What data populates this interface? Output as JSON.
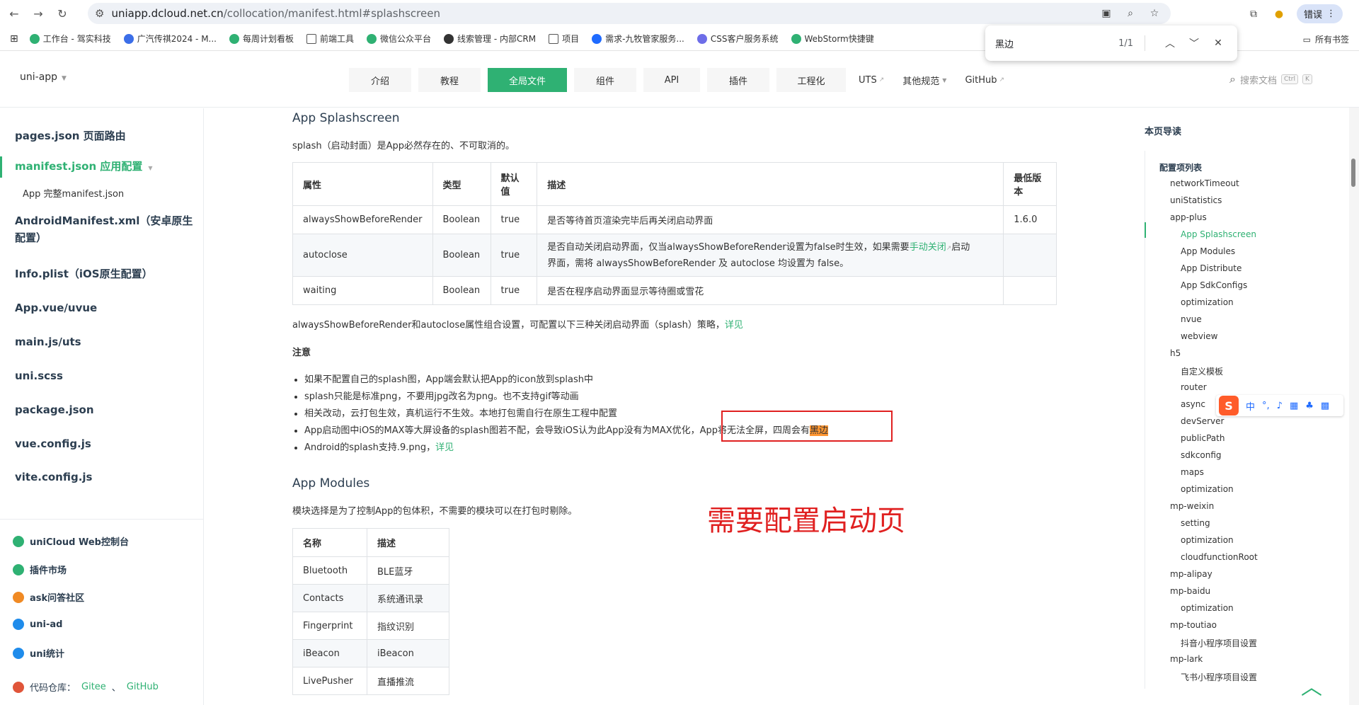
{
  "browser": {
    "url_site": "uniapp.dcloud.net.cn",
    "url_path": "/collocation/manifest.html#splashscreen",
    "error_badge": "错误",
    "bookmarks": [
      {
        "label": "工作台 - 驾实科技",
        "color": "#2fb173"
      },
      {
        "label": "广汽传祺2024 - M...",
        "color": "#3b6ee8"
      },
      {
        "label": "每周计划看板",
        "color": "#2fb173"
      },
      {
        "label": "前端工具",
        "color": ""
      },
      {
        "label": "微信公众平台",
        "color": "#2fb173"
      },
      {
        "label": "线索管理 - 内部CRM",
        "color": "#333"
      },
      {
        "label": "项目",
        "color": ""
      },
      {
        "label": "需求-九牧管家服务...",
        "color": "#1f6bff"
      },
      {
        "label": "CSS客户服务系统",
        "color": "#6d6de8"
      },
      {
        "label": "WebStorm快捷键",
        "color": "#2fb173"
      }
    ],
    "all_bookmarks": "所有书签"
  },
  "findbar": {
    "query": "黑边",
    "count": "1/1"
  },
  "header": {
    "brand": "uni-app",
    "nav": [
      {
        "label": "介绍",
        "active": false
      },
      {
        "label": "教程",
        "active": false
      },
      {
        "label": "全局文件",
        "active": true
      },
      {
        "label": "组件",
        "active": false
      },
      {
        "label": "API",
        "active": false
      },
      {
        "label": "插件",
        "active": false
      },
      {
        "label": "工程化",
        "active": false
      }
    ],
    "links": [
      "UTS",
      "其他规范",
      "GitHub"
    ],
    "search_placeholder": "搜索文档",
    "kbd1": "Ctrl",
    "kbd2": "K"
  },
  "sidebar": {
    "items": [
      "pages.json 页面路由",
      "manifest.json 应用配置",
      "App 完整manifest.json",
      "AndroidManifest.xml（安卓原生",
      "配置）",
      "Info.plist（iOS原生配置）",
      "App.vue/uvue",
      "main.js/uts",
      "uni.scss",
      "package.json",
      "vue.config.js",
      "vite.config.js"
    ],
    "footer": [
      {
        "label": "uniCloud Web控制台",
        "color": "#2fb173"
      },
      {
        "label": "插件市场",
        "color": "#2fb173"
      },
      {
        "label": "ask问答社区",
        "color": "#f08a24"
      },
      {
        "label": "uni-ad",
        "color": "#1f8ceb"
      },
      {
        "label": "uni统计",
        "color": "#1f8ceb"
      }
    ],
    "repo_label": "代码仓库：",
    "repo_gitee": "Gitee",
    "repo_sep": "、",
    "repo_github": "GitHub"
  },
  "main": {
    "h_splash": "App Splashscreen",
    "splash_intro": "splash（启动封面）是App必然存在的、不可取消的。",
    "table1": {
      "headers": [
        "属性",
        "类型",
        "默认值",
        "描述",
        "最低版本"
      ],
      "rows": [
        [
          "alwaysShowBeforeRender",
          "Boolean",
          "true",
          "是否等待首页渲染完毕后再关闭启动界面",
          "1.6.0"
        ],
        [
          "autoclose",
          "Boolean",
          "true",
          "",
          ""
        ],
        [
          "waiting",
          "Boolean",
          "true",
          "是否在程序启动界面显示等待圈或雪花",
          ""
        ]
      ],
      "autoclose_desc_a": "是否自动关闭启动界面，仅当alwaysShowBeforeRender设置为false时生效，如果需要",
      "autoclose_desc_link": "手动关闭",
      "autoclose_desc_b": "启动",
      "autoclose_desc_c": "界面，需将 alwaysShowBeforeRender 及 autoclose 均设置为 false。"
    },
    "combo_text": "alwaysShowBeforeRender和autoclose属性组合设置，可配置以下三种关闭启动界面（splash）策略，",
    "combo_link": "详见",
    "notice_title": "注意",
    "notes": [
      "如果不配置自己的splash图，App端会默认把App的icon放到splash中",
      "splash只能是标准png，不要用jpg改名为png。也不支持gif等动画",
      "相关改动，云打包生效，真机运行不生效。本地打包需自行在原生工程中配置"
    ],
    "note4_a": "App启动图中iOS的MAX等大屏设备的splash图若不配，会导致iOS认为此App没有为MAX优化，App将无法全屏，四周会有",
    "note4_hl": "黑边",
    "note5": "Android的splash支持.9.png，",
    "note5_link": "详见",
    "h_modules": "App Modules",
    "modules_intro": "模块选择是为了控制App的包体积，不需要的模块可以在打包时剔除。",
    "table2": {
      "headers": [
        "名称",
        "描述"
      ],
      "rows": [
        [
          "Bluetooth",
          "BLE蓝牙"
        ],
        [
          "Contacts",
          "系统通讯录"
        ],
        [
          "Fingerprint",
          "指纹识别"
        ],
        [
          "iBeacon",
          "iBeacon"
        ],
        [
          "LivePusher",
          "直播推流"
        ]
      ]
    },
    "annotation": "需要配置启动页"
  },
  "toc": {
    "title": "本页导读",
    "items": [
      "配置项列表",
      "networkTimeout",
      "uniStatistics",
      "app-plus",
      "App Splashscreen",
      "App Modules",
      "App Distribute",
      "App SdkConfigs",
      "optimization",
      "nvue",
      "webview",
      "h5",
      "自定义模板",
      "router",
      "async",
      "devServer",
      "publicPath",
      "sdkconfig",
      "maps",
      "optimization",
      "mp-weixin",
      "setting",
      "optimization",
      "cloudfunctionRoot",
      "mp-alipay",
      "mp-baidu",
      "optimization",
      "mp-toutiao",
      "抖音小程序项目设置",
      "mp-lark",
      "飞书小程序项目设置"
    ]
  },
  "ime": {
    "cn": "中"
  }
}
